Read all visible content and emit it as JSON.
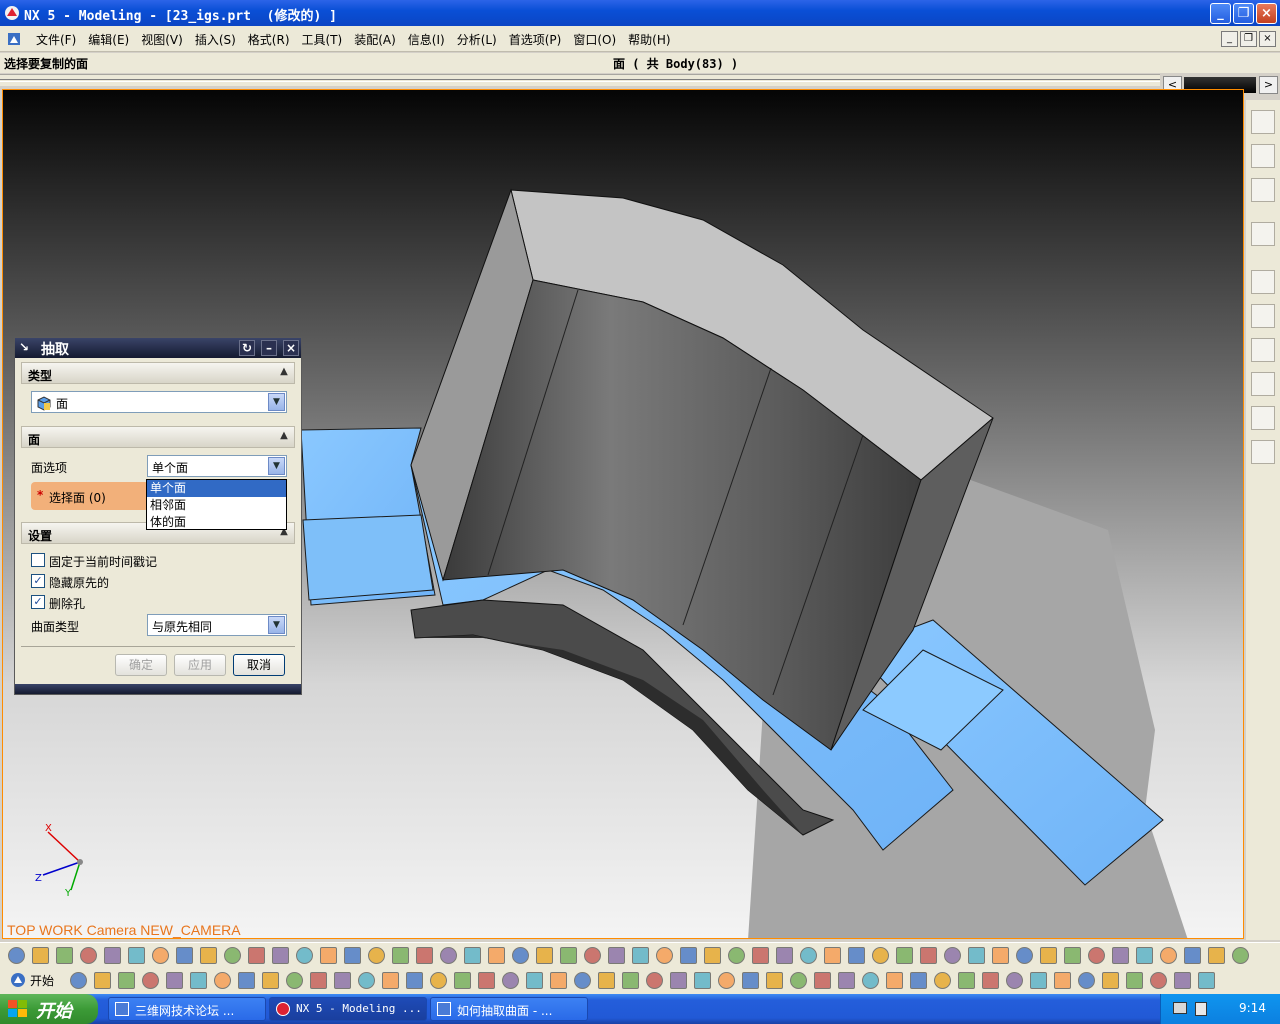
{
  "window": {
    "title": "NX 5 - Modeling - [23_igs.prt  (修改的) ]",
    "minimize_label": "_",
    "restore_label": "❐",
    "close_label": "×"
  },
  "menubar": {
    "items": [
      "文件(F)",
      "编辑(E)",
      "视图(V)",
      "插入(S)",
      "格式(R)",
      "工具(T)",
      "装配(A)",
      "信息(I)",
      "分析(L)",
      "首选项(P)",
      "窗口(O)",
      "帮助(H)"
    ]
  },
  "prompt": {
    "text": "选择要复制的面",
    "status": "面 ( 共 Body(83) )"
  },
  "viewport": {
    "label": "TOP WORK Camera NEW_CAMERA",
    "axis_x": "X",
    "axis_y": "Y",
    "axis_z": "Z"
  },
  "dialog": {
    "title": "抽取",
    "type_group": {
      "header": "类型",
      "value": "面"
    },
    "face_group": {
      "header": "面",
      "option_label": "面选项",
      "option_value": "单个面",
      "select_label": "选择面 (0)",
      "required_mark": "*"
    },
    "dropdown_options": [
      "单个面",
      "相邻面",
      "体的面"
    ],
    "settings_group": {
      "header": "设置",
      "checkbox1": {
        "label": "固定于当前时间戳记",
        "checked": false
      },
      "checkbox2": {
        "label": "隐藏原先的",
        "checked": true
      },
      "checkbox3": {
        "label": "删除孔",
        "checked": true
      },
      "surface_label": "曲面类型",
      "surface_value": "与原先相同"
    },
    "buttons": {
      "ok": "确定",
      "apply": "应用",
      "cancel": "取消"
    }
  },
  "toolbar": {
    "start_label": "开始"
  },
  "taskbar": {
    "start": "开始",
    "tasks": [
      "三维网技术论坛 ...",
      "NX 5 - Modeling ...",
      "如何抽取曲面 - ..."
    ],
    "clock": "9:14"
  },
  "colors": {
    "title_blue": "#0a4fd6",
    "viewport_top": "#050505",
    "viewport_bottom": "#f4f4f4",
    "face_blue": "#7fc0ff",
    "solid_gray": "#8a8a8a",
    "accent_orange": "#e8761e"
  }
}
